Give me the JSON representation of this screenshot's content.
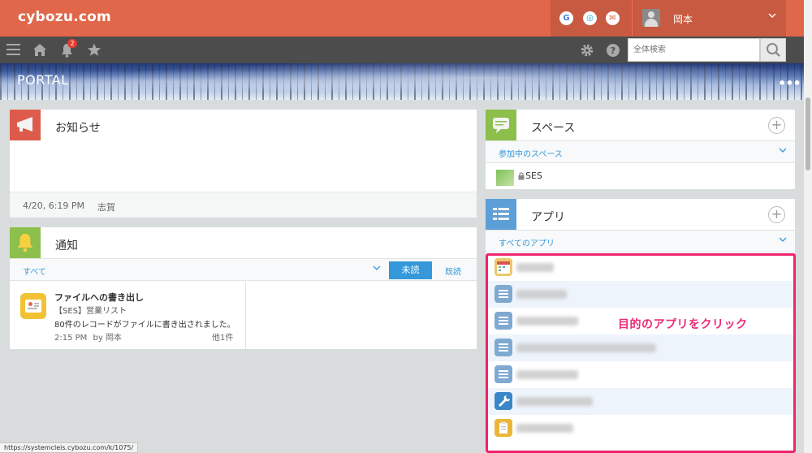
{
  "header": {
    "logo": "cybozu.com",
    "services": [
      {
        "icon": "google-icon",
        "glyph": "G",
        "color": "#4a7bdd"
      },
      {
        "icon": "garoon-icon",
        "glyph": "◎",
        "color": "#1fa3c7"
      },
      {
        "icon": "mail-icon",
        "glyph": "✉",
        "color": "#e0674a"
      }
    ],
    "user_name": "岡本",
    "notification_count": "2",
    "search_placeholder": "全体検索"
  },
  "banner": {
    "title": "PORTAL",
    "menu_glyph": "•••"
  },
  "notices": {
    "title": "お知らせ",
    "timestamp": "4/20, 6:19 PM",
    "author": "志賀"
  },
  "notifications": {
    "title": "通知",
    "filter_label": "すべて",
    "unread_label": "未読",
    "read_label": "既読",
    "item": {
      "title": "ファイルへの書き出し",
      "source": "【SES】営業リスト",
      "message": "80件のレコードがファイルに書き出されました。",
      "time": "2:15 PM",
      "by_label": "by",
      "by_user": "岡本",
      "others": "他1件"
    }
  },
  "spaces": {
    "title": "スペース",
    "filter_label": "参加中のスペース",
    "items": [
      {
        "label": "SES",
        "locked": true
      }
    ]
  },
  "apps": {
    "title": "アプリ",
    "filter_label": "すべてのアプリ",
    "items": [
      {
        "icon": "calendar-app-icon",
        "color": "#e9c96a"
      },
      {
        "icon": "list-app-icon",
        "color": "#7fa9d1"
      },
      {
        "icon": "list-app-icon",
        "color": "#7fa9d1"
      },
      {
        "icon": "list-app-icon",
        "color": "#7fa9d1"
      },
      {
        "icon": "list-app-icon",
        "color": "#7fa9d1"
      },
      {
        "icon": "wrench-app-icon",
        "color": "#3a86c8"
      },
      {
        "icon": "clipboard-app-icon",
        "color": "#eab63a"
      }
    ]
  },
  "annotation": {
    "text": "目的のアプリをクリック",
    "color": "#ea2b78"
  },
  "status_bar": {
    "url": "https://systemcleis.cybozu.com/k/1075/"
  }
}
